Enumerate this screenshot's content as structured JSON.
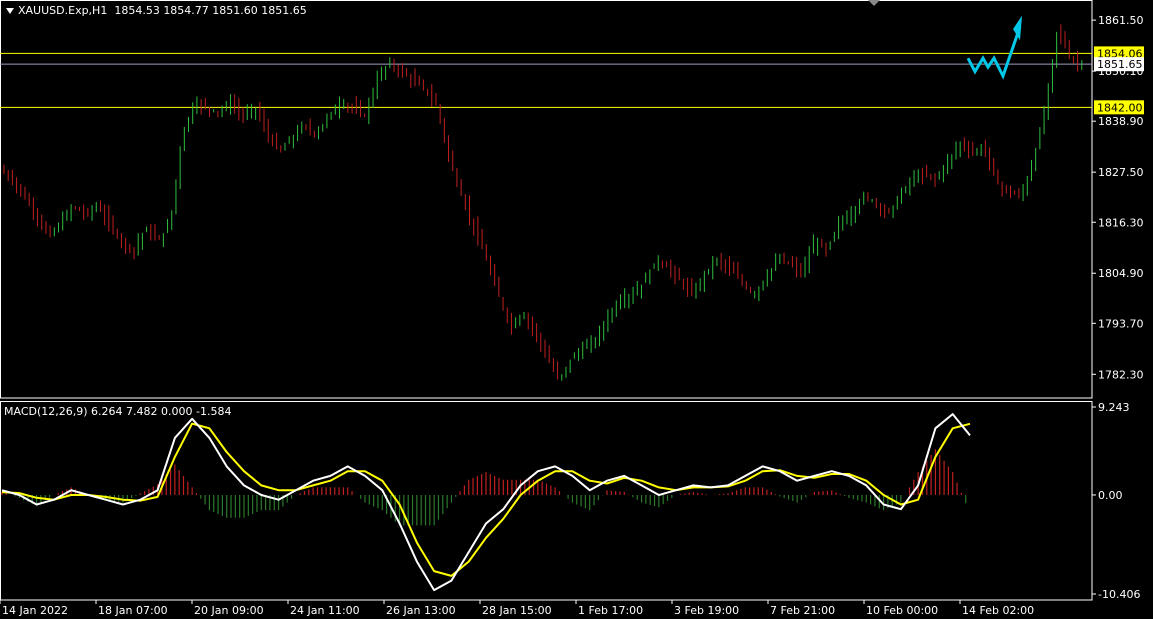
{
  "window": {
    "symbol": "XAUUSD.Exp,H1",
    "ohlc": "1854.53 1854.77 1851.60 1851.65"
  },
  "macd_title": "MACD(12,26,9) 6.264 7.482 0.000 -1.584",
  "colors": {
    "background": "#000000",
    "bull_candle": "#2fbf3f",
    "bear_candle": "#c02020",
    "level_line": "#ffff00",
    "bid_line": "#a0a0c0",
    "macd_line": "#ffffff",
    "signal_line": "#ffff00",
    "hist_pos": "#c02020",
    "hist_neg": "#2a7a2a",
    "forecast": "#00c8e8"
  },
  "chart_data": [
    {
      "type": "candlestick",
      "title": "",
      "ylim": [
        1777.0,
        1866.0
      ],
      "y_ticks": [
        "1861.50",
        "1850.10",
        "1838.90",
        "1827.50",
        "1816.30",
        "1804.90",
        "1793.70",
        "1782.30"
      ],
      "x_ticks": [
        "14 Jan 2022",
        "18 Jan 07:00",
        "20 Jan 09:00",
        "24 Jan 11:00",
        "26 Jan 13:00",
        "28 Jan 15:00",
        "1 Feb 17:00",
        "3 Feb 19:00",
        "7 Feb 21:00",
        "10 Feb 00:00",
        "14 Feb 02:00"
      ],
      "price_labels": [
        {
          "value": 1854.06,
          "text": "1854.06",
          "style": "yellow-box"
        },
        {
          "value": 1851.65,
          "text": "1851.65",
          "style": "white-box"
        },
        {
          "value": 1842.0,
          "text": "1842.00",
          "style": "yellow-box"
        }
      ],
      "horizontal_levels": [
        1854.06,
        1842.0
      ],
      "bid_level": 1851.65,
      "close_path": [
        [
          0,
          1828
        ],
        [
          6,
          1826
        ],
        [
          12,
          1822
        ],
        [
          18,
          1818
        ],
        [
          24,
          1813
        ],
        [
          30,
          1816
        ],
        [
          36,
          1820
        ],
        [
          42,
          1818
        ],
        [
          48,
          1820
        ],
        [
          54,
          1816
        ],
        [
          60,
          1812
        ],
        [
          66,
          1810
        ],
        [
          72,
          1815
        ],
        [
          78,
          1812
        ],
        [
          84,
          1816
        ],
        [
          90,
          1836
        ],
        [
          96,
          1843
        ],
        [
          102,
          1842
        ],
        [
          108,
          1841
        ],
        [
          114,
          1843
        ],
        [
          120,
          1840
        ],
        [
          126,
          1842
        ],
        [
          132,
          1836
        ],
        [
          138,
          1832
        ],
        [
          144,
          1835
        ],
        [
          150,
          1838
        ],
        [
          156,
          1836
        ],
        [
          162,
          1840
        ],
        [
          168,
          1843
        ],
        [
          174,
          1842
        ],
        [
          180,
          1840
        ],
        [
          186,
          1848
        ],
        [
          192,
          1852
        ],
        [
          198,
          1850
        ],
        [
          204,
          1848
        ],
        [
          210,
          1846
        ],
        [
          216,
          1842
        ],
        [
          222,
          1830
        ],
        [
          228,
          1822
        ],
        [
          234,
          1815
        ],
        [
          240,
          1808
        ],
        [
          246,
          1800
        ],
        [
          252,
          1793
        ],
        [
          258,
          1796
        ],
        [
          264,
          1792
        ],
        [
          270,
          1786
        ],
        [
          276,
          1781
        ],
        [
          282,
          1786
        ],
        [
          288,
          1788
        ],
        [
          294,
          1790
        ],
        [
          300,
          1795
        ],
        [
          306,
          1799
        ],
        [
          312,
          1800
        ],
        [
          318,
          1803
        ],
        [
          324,
          1808
        ],
        [
          330,
          1806
        ],
        [
          336,
          1803
        ],
        [
          342,
          1800
        ],
        [
          348,
          1805
        ],
        [
          354,
          1808
        ],
        [
          360,
          1806
        ],
        [
          366,
          1803
        ],
        [
          372,
          1800
        ],
        [
          378,
          1804
        ],
        [
          384,
          1808
        ],
        [
          390,
          1807
        ],
        [
          396,
          1805
        ],
        [
          402,
          1812
        ],
        [
          408,
          1810
        ],
        [
          414,
          1816
        ],
        [
          420,
          1818
        ],
        [
          426,
          1822
        ],
        [
          432,
          1821
        ],
        [
          438,
          1818
        ],
        [
          444,
          1822
        ],
        [
          450,
          1826
        ],
        [
          456,
          1827
        ],
        [
          462,
          1826
        ],
        [
          468,
          1830
        ],
        [
          474,
          1834
        ],
        [
          480,
          1832
        ],
        [
          486,
          1833
        ],
        [
          492,
          1825
        ],
        [
          498,
          1823
        ],
        [
          504,
          1822
        ],
        [
          510,
          1830
        ],
        [
          516,
          1842
        ],
        [
          522,
          1860
        ],
        [
          528,
          1853
        ],
        [
          534,
          1851.65
        ]
      ]
    },
    {
      "type": "macd",
      "title": "MACD(12,26,9)",
      "ylim": [
        -10.406,
        9.243
      ],
      "y_ticks": [
        "9.243",
        "0.00",
        "-10.406"
      ],
      "macd": [
        0.5,
        0.0,
        -1.0,
        -0.5,
        0.5,
        0.0,
        -0.5,
        -1.0,
        -0.5,
        0.5,
        6.0,
        8.0,
        6.0,
        3.0,
        1.0,
        0.0,
        -0.5,
        0.5,
        1.5,
        2.0,
        3.0,
        2.0,
        0.5,
        -3.0,
        -7.0,
        -10.0,
        -9.0,
        -6.0,
        -3.0,
        -1.5,
        1.0,
        2.5,
        3.0,
        2.0,
        0.5,
        1.5,
        2.0,
        1.0,
        0.0,
        0.5,
        1.0,
        0.8,
        1.0,
        2.0,
        3.0,
        2.5,
        1.5,
        2.0,
        2.5,
        2.0,
        1.0,
        -1.0,
        -1.5,
        1.0,
        7.0,
        8.5,
        6.264
      ],
      "signal": [
        0.3,
        0.2,
        -0.3,
        -0.5,
        0.0,
        0.0,
        -0.2,
        -0.5,
        -0.6,
        -0.2,
        4.0,
        7.5,
        7.0,
        4.5,
        2.5,
        1.0,
        0.5,
        0.5,
        1.0,
        1.5,
        2.5,
        2.5,
        1.5,
        -1.0,
        -5.0,
        -8.0,
        -8.5,
        -7.0,
        -4.5,
        -2.5,
        0.0,
        1.5,
        2.5,
        2.5,
        1.5,
        1.2,
        1.8,
        1.5,
        0.8,
        0.5,
        0.8,
        0.8,
        0.9,
        1.5,
        2.5,
        2.6,
        2.0,
        1.8,
        2.2,
        2.2,
        1.5,
        0.0,
        -1.0,
        -0.5,
        4.0,
        7.0,
        7.482
      ]
    }
  ]
}
